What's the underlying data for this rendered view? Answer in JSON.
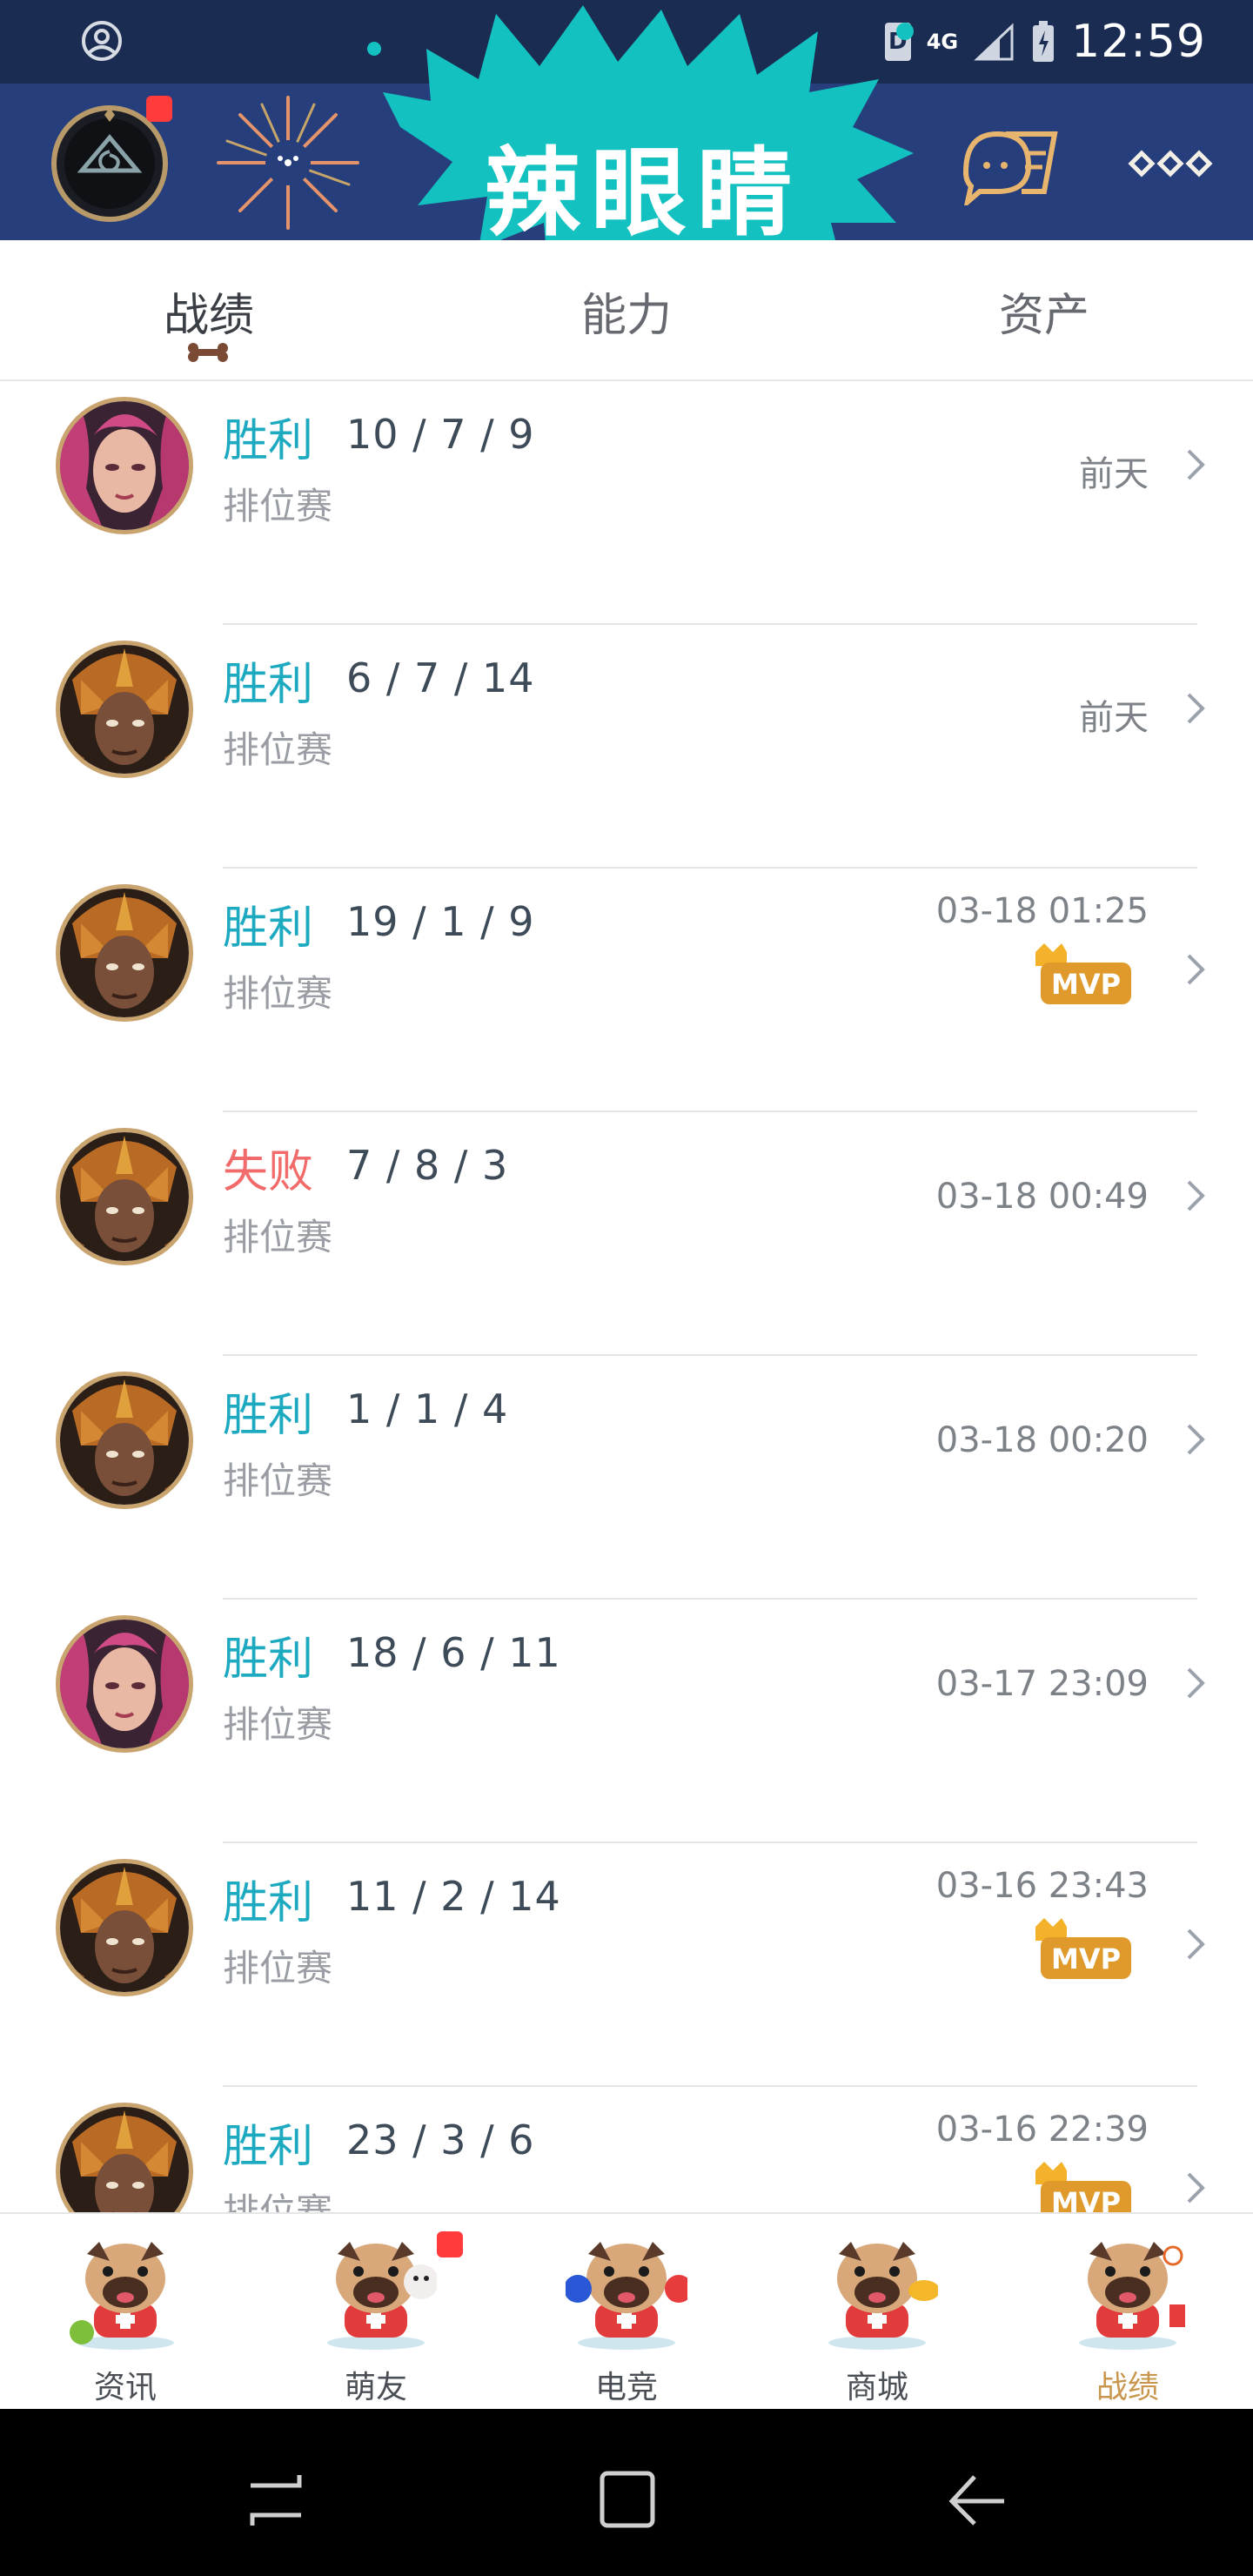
{
  "status_bar": {
    "indicator": "D",
    "network": "4G",
    "time": "12:59"
  },
  "header": {
    "splash_text": "辣眼睛",
    "icons": [
      "avatar",
      "firework",
      "chat-icon",
      "more-icon"
    ]
  },
  "tabs": [
    {
      "label": "战绩",
      "active": true
    },
    {
      "label": "能力",
      "active": false
    },
    {
      "label": "资产",
      "active": false
    }
  ],
  "matches": [
    {
      "hero": "vi",
      "result": "胜利",
      "kda": "10 / 7 / 9",
      "mode": "排位赛",
      "time": "前天",
      "mvp": false
    },
    {
      "hero": "jarvan",
      "result": "胜利",
      "kda": "6 / 7 / 14",
      "mode": "排位赛",
      "time": "前天",
      "mvp": false
    },
    {
      "hero": "jarvan",
      "result": "胜利",
      "kda": "19 / 1 / 9",
      "mode": "排位赛",
      "time": "03-18 01:25",
      "mvp": true
    },
    {
      "hero": "jarvan",
      "result": "失败",
      "kda": "7 / 8 / 3",
      "mode": "排位赛",
      "time": "03-18 00:49",
      "mvp": false
    },
    {
      "hero": "jarvan",
      "result": "胜利",
      "kda": "1 / 1 / 4",
      "mode": "排位赛",
      "time": "03-18 00:20",
      "mvp": false
    },
    {
      "hero": "vi",
      "result": "胜利",
      "kda": "18 / 6 / 11",
      "mode": "排位赛",
      "time": "03-17 23:09",
      "mvp": false
    },
    {
      "hero": "jarvan",
      "result": "胜利",
      "kda": "11 / 2 / 14",
      "mode": "排位赛",
      "time": "03-16 23:43",
      "mvp": true
    },
    {
      "hero": "jarvan",
      "result": "胜利",
      "kda": "23 / 3 / 6",
      "mode": "排位赛",
      "time": "03-16 22:39",
      "mvp": true
    }
  ],
  "mvp_label": "MVP",
  "bottom_nav": [
    {
      "label": "资讯",
      "active": false,
      "badge": false
    },
    {
      "label": "萌友",
      "active": false,
      "badge": true
    },
    {
      "label": "电竞",
      "active": false,
      "badge": false
    },
    {
      "label": "商城",
      "active": false,
      "badge": false
    },
    {
      "label": "战绩",
      "active": true,
      "badge": false
    }
  ],
  "colors": {
    "win": "#1daac0",
    "lose": "#f26b6b",
    "header_bg": "#263f7c",
    "status_bg": "#1b2c52",
    "splash": "#13c2c0",
    "active_nav": "#c9964d"
  }
}
